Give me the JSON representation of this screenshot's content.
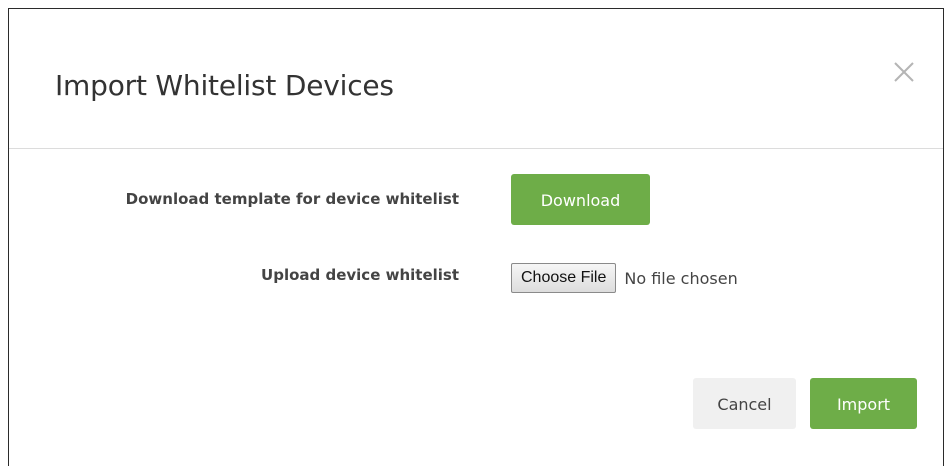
{
  "dialog": {
    "title": "Import Whitelist Devices",
    "close_icon": "close-icon"
  },
  "download_row": {
    "label": "Download template for device whitelist",
    "button_label": "Download"
  },
  "upload_row": {
    "label": "Upload device whitelist",
    "choose_file_label": "Choose File",
    "file_status": "No file chosen"
  },
  "footer": {
    "cancel_label": "Cancel",
    "import_label": "Import"
  },
  "colors": {
    "accent_green": "#6ead48",
    "cancel_bg": "#f0f0f0",
    "title_text": "#333333",
    "label_text": "#444444"
  }
}
